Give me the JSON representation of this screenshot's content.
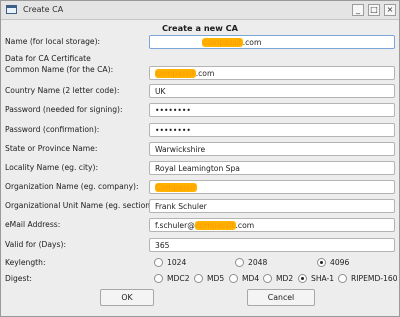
{
  "window": {
    "title": "Create CA",
    "minimize_glyph": "_",
    "maximize_glyph": "□",
    "close_glyph": "×"
  },
  "heading": "Create a new CA",
  "fields": {
    "local_storage": {
      "label": "Name (for local storage):",
      "value_redacted": "compassit",
      "value_suffix": ".com"
    },
    "section_label": "Data for CA Certificate",
    "common_name": {
      "label": "Common Name (for the CA):",
      "value_redacted": "compassit",
      "value_suffix": ".com"
    },
    "country": {
      "label": "Country Name (2 letter code):",
      "value": "UK"
    },
    "password_sign": {
      "label": "Password (needed for signing):",
      "value": "••••••••"
    },
    "password_confirm": {
      "label": "Password (confirmation):",
      "value": "••••••••"
    },
    "state": {
      "label": "State or Province Name:",
      "value": "Warwickshire"
    },
    "locality": {
      "label": "Locality Name (eg. city):",
      "value": "Royal Leamington Spa"
    },
    "organization": {
      "label": "Organization Name (eg. company):",
      "value_redacted": "Compassit"
    },
    "org_unit": {
      "label": "Organizational Unit Name (eg. section):",
      "value": "Frank Schuler"
    },
    "email": {
      "label": "eMail Address:",
      "value_prefix": "f.schuler@",
      "value_redacted": "compassit",
      "value_suffix": ".com"
    },
    "valid_days": {
      "label": "Valid for (Days):",
      "value": "365"
    }
  },
  "keylength": {
    "label": "Keylength:",
    "options": [
      "1024",
      "2048",
      "4096"
    ],
    "selected": "4096"
  },
  "digest": {
    "label": "Digest:",
    "options": [
      "MDC2",
      "MD5",
      "MD4",
      "MD2",
      "SHA-1",
      "RIPEMD-160"
    ],
    "selected": "SHA-1"
  },
  "buttons": {
    "ok": "OK",
    "cancel": "Cancel"
  }
}
